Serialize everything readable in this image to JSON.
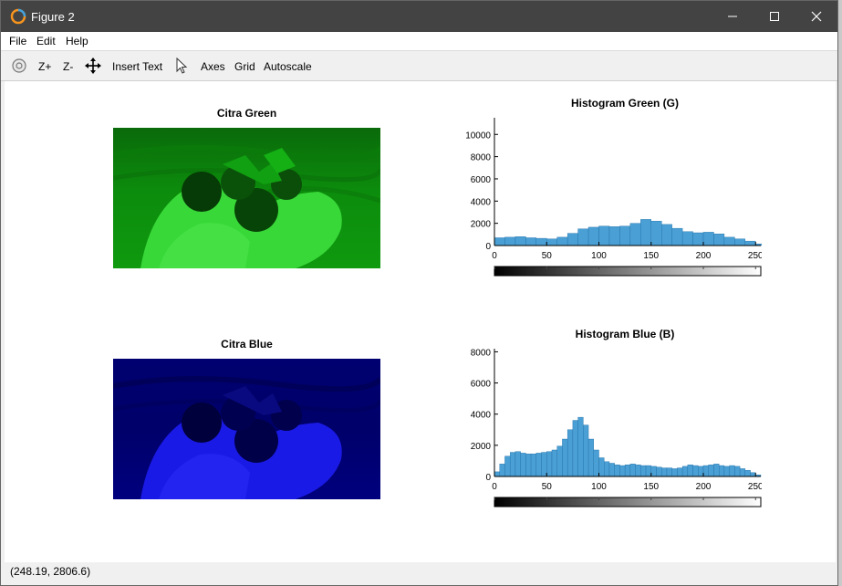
{
  "window": {
    "title": "Figure 2"
  },
  "menu": [
    "File",
    "Edit",
    "Help"
  ],
  "toolbar": {
    "zoom_in": "Z+",
    "zoom_out": "Z-",
    "insert_text": "Insert Text",
    "axes": "Axes",
    "grid": "Grid",
    "autoscale": "Autoscale"
  },
  "images": {
    "green_title": "Citra Green",
    "blue_title": "Citra Blue"
  },
  "status": {
    "coordinates": "(248.19, 2806.6)"
  },
  "colors": {
    "bar": "#4a9fd4",
    "green_channel": "#00c000",
    "blue_channel": "#0000ff"
  },
  "chart_data": [
    {
      "type": "bar",
      "title": "Histogram Green (G)",
      "xlim": [
        0,
        255
      ],
      "ylim": [
        0,
        11500
      ],
      "xticks": [
        0,
        50,
        100,
        150,
        200,
        250
      ],
      "yticks": [
        0,
        2000,
        4000,
        6000,
        8000,
        10000
      ],
      "x": [
        0,
        10,
        20,
        30,
        40,
        50,
        60,
        70,
        80,
        90,
        100,
        110,
        120,
        130,
        140,
        150,
        160,
        170,
        180,
        190,
        200,
        210,
        220,
        230,
        240,
        250
      ],
      "values": [
        700,
        750,
        800,
        700,
        650,
        600,
        750,
        1100,
        1500,
        1650,
        1750,
        1700,
        1750,
        2000,
        2350,
        2200,
        1900,
        1550,
        1250,
        1150,
        1200,
        1050,
        750,
        600,
        400,
        150
      ],
      "grid": false
    },
    {
      "type": "bar",
      "title": "Histogram Blue (B)",
      "xlim": [
        0,
        255
      ],
      "ylim": [
        0,
        8200
      ],
      "xticks": [
        0,
        50,
        100,
        150,
        200,
        250
      ],
      "yticks": [
        0,
        2000,
        4000,
        6000,
        8000
      ],
      "x": [
        0,
        5,
        10,
        15,
        20,
        25,
        30,
        35,
        40,
        45,
        50,
        55,
        60,
        65,
        70,
        75,
        80,
        85,
        90,
        95,
        100,
        105,
        110,
        115,
        120,
        125,
        130,
        135,
        140,
        145,
        150,
        155,
        160,
        165,
        170,
        175,
        180,
        185,
        190,
        195,
        200,
        205,
        210,
        215,
        220,
        225,
        230,
        235,
        240,
        245,
        250
      ],
      "values": [
        300,
        800,
        1300,
        1550,
        1600,
        1500,
        1450,
        1450,
        1500,
        1550,
        1600,
        1700,
        1950,
        2400,
        3000,
        3600,
        3800,
        3300,
        2400,
        1700,
        1200,
        950,
        850,
        750,
        700,
        750,
        800,
        750,
        700,
        700,
        650,
        600,
        550,
        550,
        500,
        550,
        650,
        750,
        700,
        650,
        700,
        750,
        800,
        700,
        650,
        700,
        650,
        500,
        400,
        250,
        100
      ],
      "grid": false
    }
  ]
}
